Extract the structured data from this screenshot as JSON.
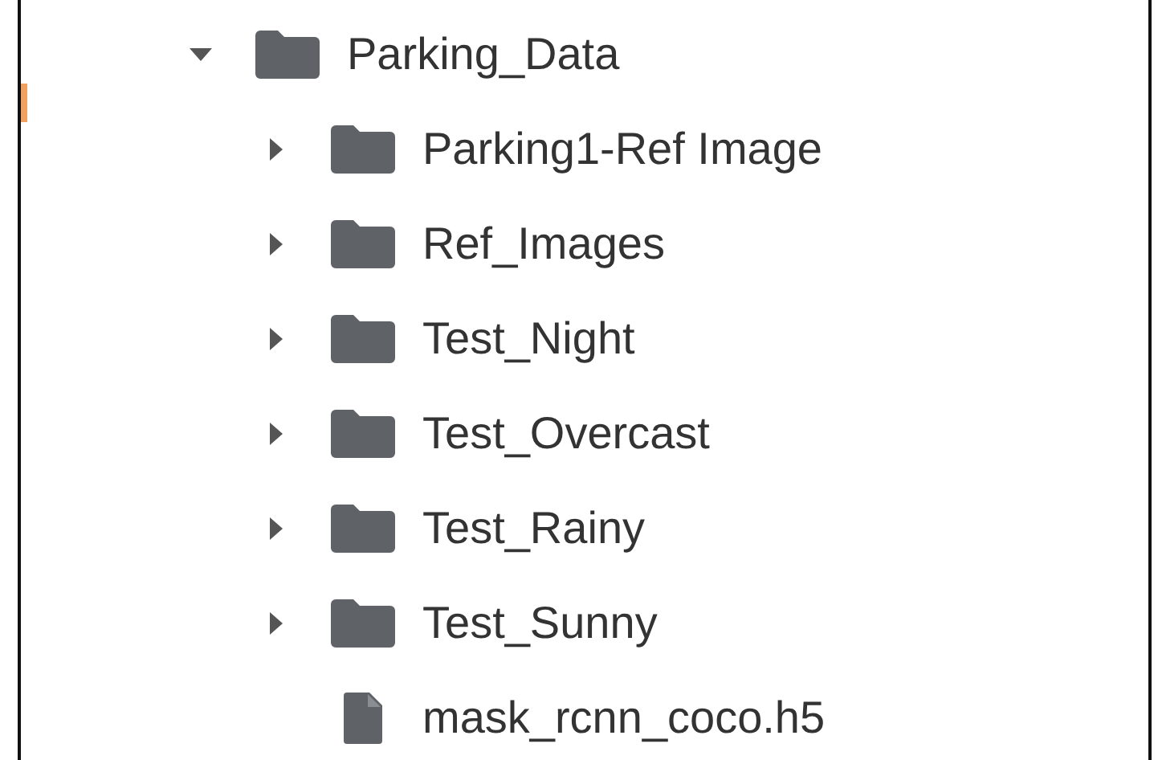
{
  "tree": {
    "kind": "folder",
    "name": "Parking_Data",
    "expanded": true,
    "children": [
      {
        "kind": "folder",
        "name": "Parking1-Ref Image",
        "expanded": false
      },
      {
        "kind": "folder",
        "name": "Ref_Images",
        "expanded": false
      },
      {
        "kind": "folder",
        "name": "Test_Night",
        "expanded": false
      },
      {
        "kind": "folder",
        "name": "Test_Overcast",
        "expanded": false
      },
      {
        "kind": "folder",
        "name": "Test_Rainy",
        "expanded": false
      },
      {
        "kind": "folder",
        "name": "Test_Sunny",
        "expanded": false
      },
      {
        "kind": "file",
        "name": "mask_rcnn_coco.h5"
      }
    ]
  }
}
